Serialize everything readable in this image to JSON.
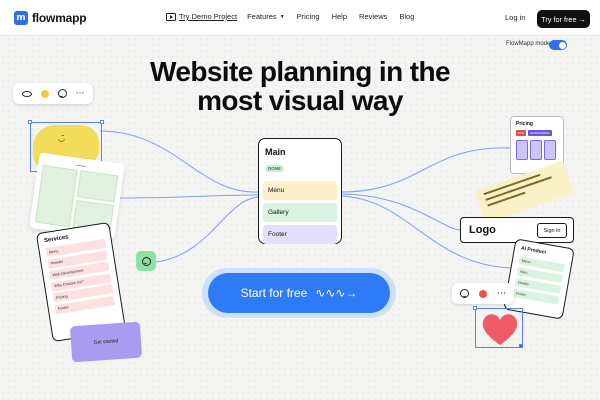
{
  "nav": {
    "logo_mark": "m",
    "logo_text": "flowmapp",
    "links": [
      {
        "label": "Try Demo Project"
      },
      {
        "label": "Features"
      },
      {
        "label": "Pricing"
      },
      {
        "label": "Help"
      },
      {
        "label": "Reviews"
      },
      {
        "label": "Blog"
      }
    ],
    "login": "Log in",
    "try_free": "Try for free",
    "try_free_arrow": "→"
  },
  "mode_toggle": {
    "label": "FlowMapp mode",
    "on": true
  },
  "hero": {
    "title_line1": "Website planning in the",
    "title_line2": "most visual way"
  },
  "main_card": {
    "title": "Main",
    "badge": "DONE",
    "rows": [
      "Menu",
      "Gallery",
      "Footer"
    ]
  },
  "cta": {
    "label": "Start for free",
    "squiggle": "∿∿∿→"
  },
  "services_card": {
    "title": "Services",
    "items": [
      "Menu",
      "Header",
      "Web Development",
      "Why Choose Us?",
      "Pricing",
      "Footer"
    ]
  },
  "get_started": "Get started",
  "pricing_card": {
    "title": "Pricing",
    "tags": [
      {
        "label": "MAP",
        "color": "#e04d4d"
      },
      {
        "label": "IN PROGRESS",
        "color": "#6a55e0"
      }
    ]
  },
  "logo_card": {
    "logo": "Logo",
    "signin": "Sign in"
  },
  "ai_card": {
    "title": "AI Product",
    "items": [
      "Menu",
      "Hero",
      "Details",
      "Footer"
    ]
  },
  "colors": {
    "accent": "#2d7bf6",
    "blob_yellow": "#f2dc5a",
    "toolbar_dot_yellow": "#f5c842",
    "toolbar_dot_red": "#e8524a",
    "heart": "#ee5b66"
  },
  "icons": [
    "demo-play-icon",
    "ellipse-icon",
    "yellow-dot-icon",
    "smile-icon",
    "more-icon",
    "red-dot-icon",
    "heart-icon"
  ]
}
